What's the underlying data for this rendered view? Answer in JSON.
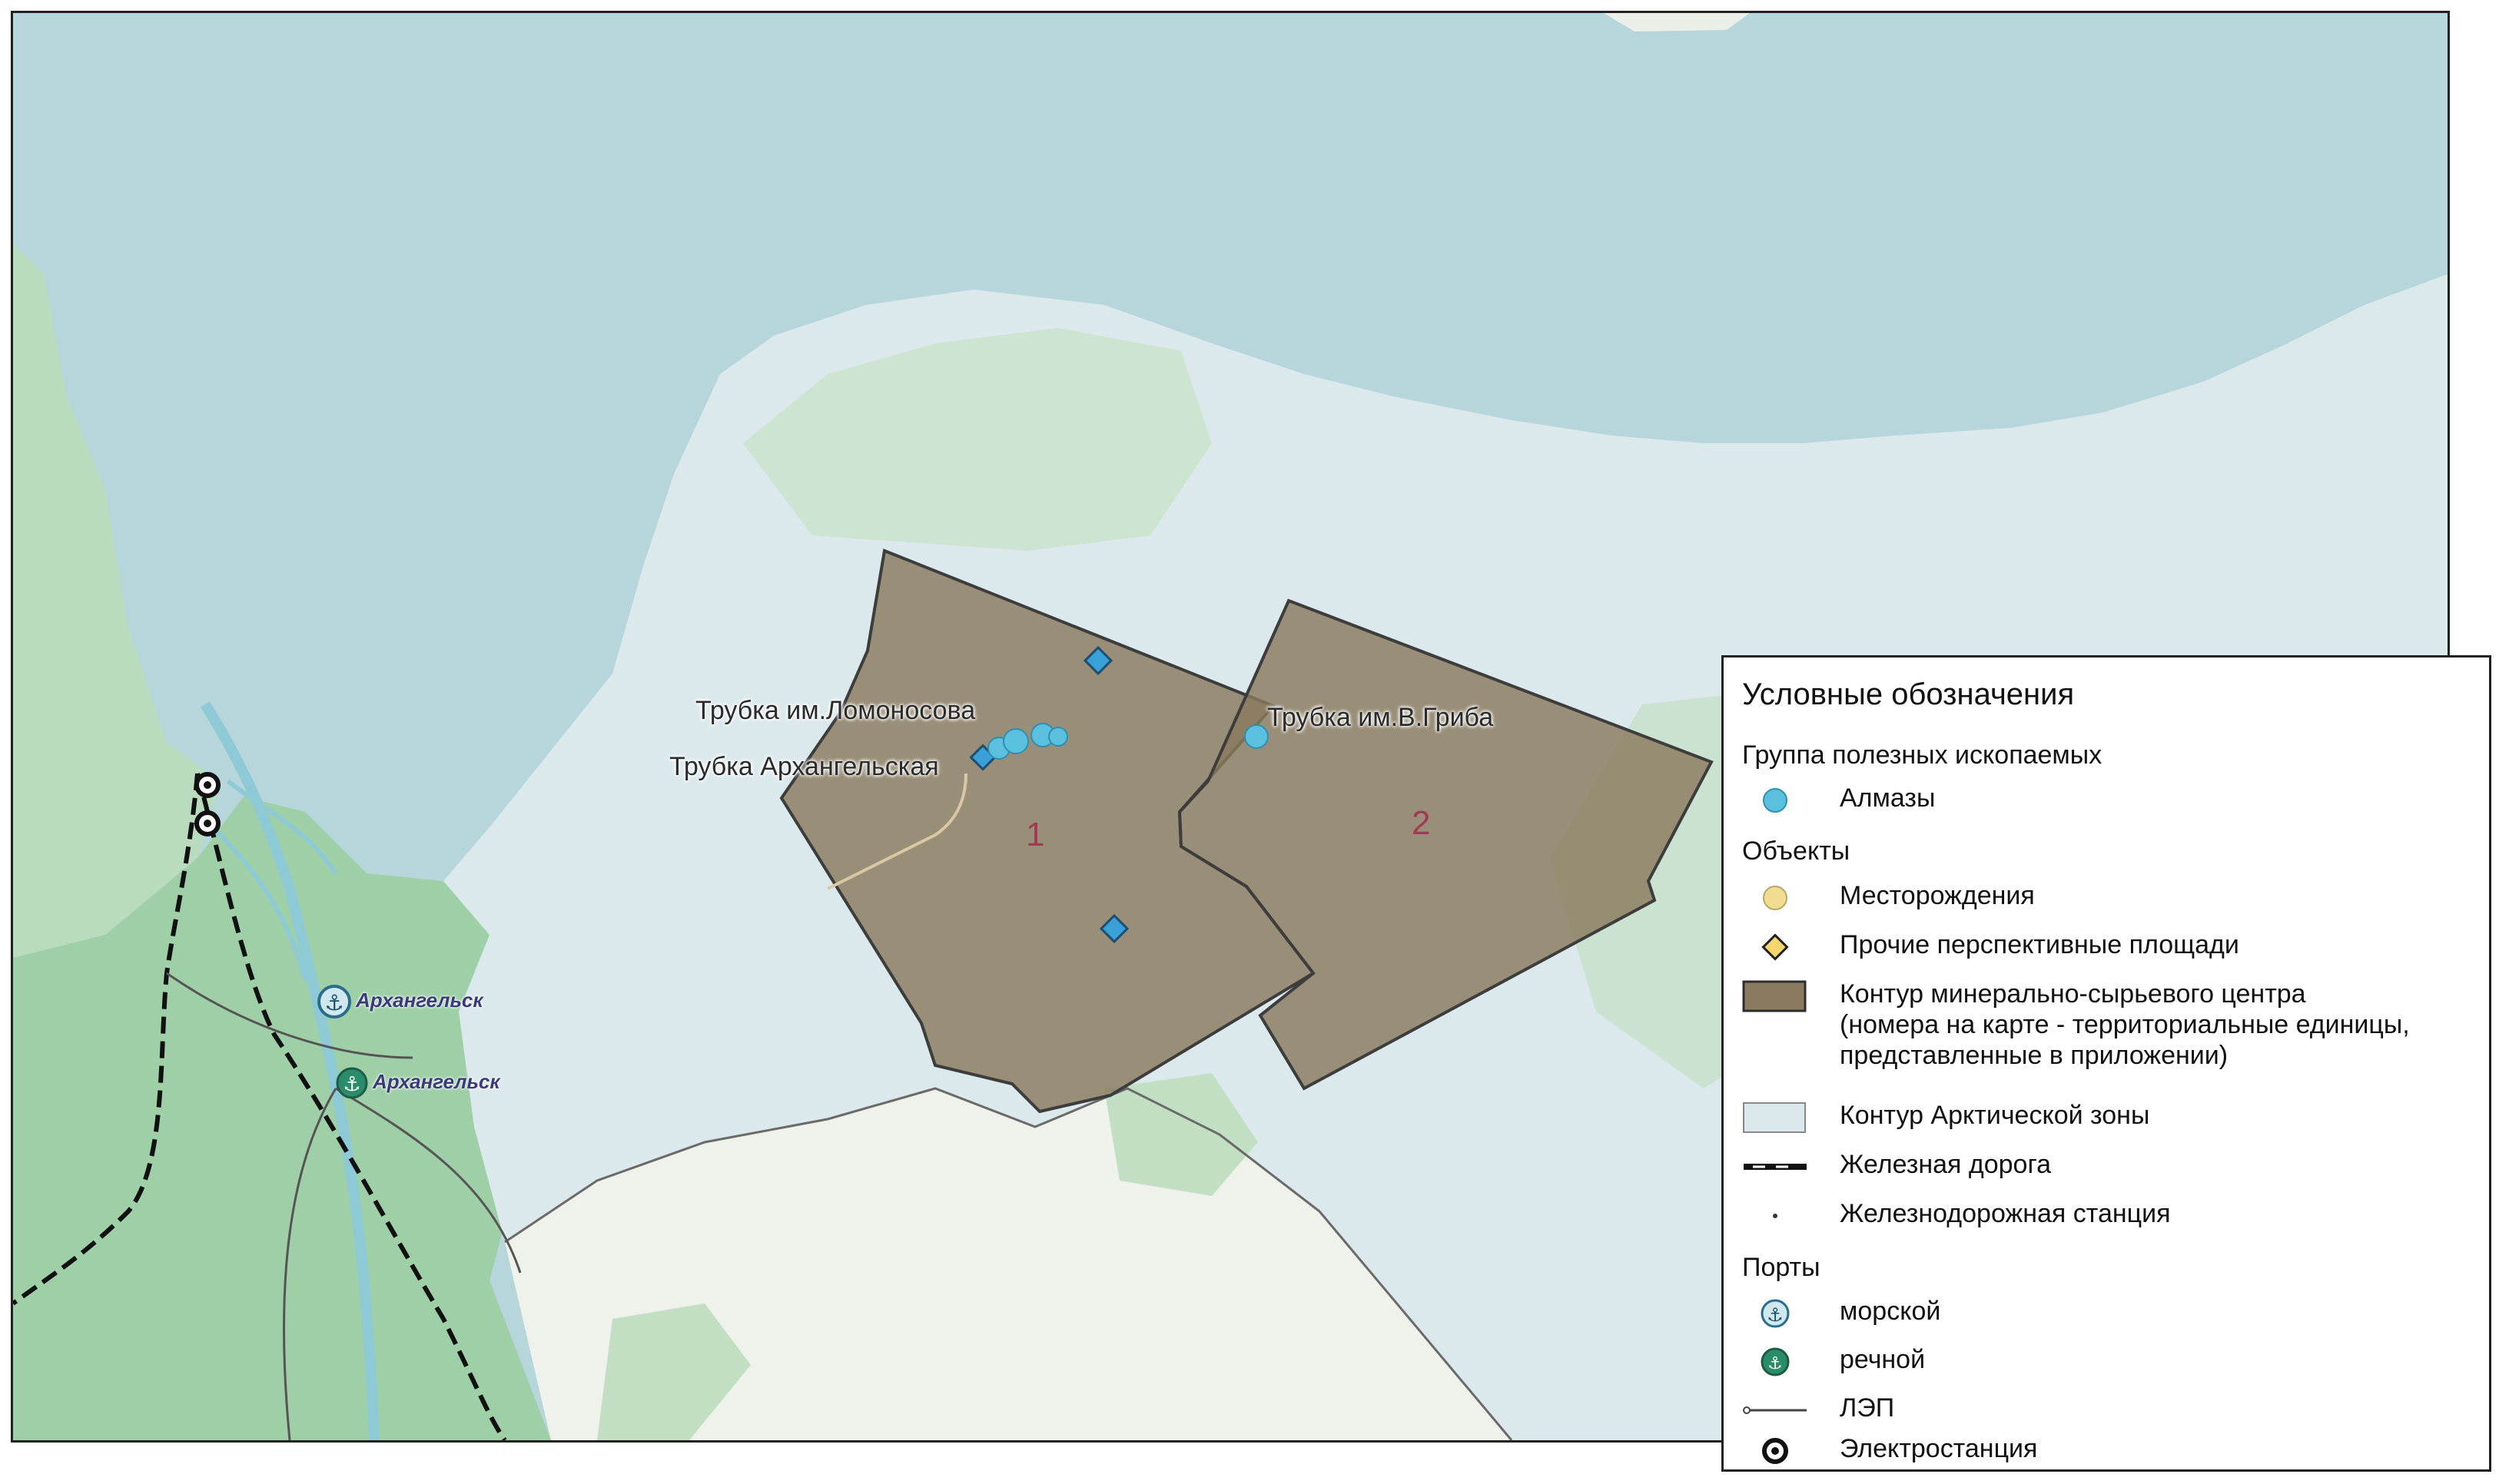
{
  "map": {
    "labels": {
      "lomonosov": "Трубка им.Ломоносова",
      "arkhangelskaya": "Трубка Архангельская",
      "griba": "Трубка им.В.Гриба",
      "unit1": "1",
      "unit2": "2",
      "city_sea": "Архангельск",
      "city_river": "Архангельск"
    },
    "colors": {
      "sea": "#b7d6dc",
      "arctic_zone": "#dce9ec",
      "forest": "#b5d8b8",
      "land": "#eef2ea",
      "mineral_center_fill": "#8a7a5e",
      "diamond": "#5bc0de",
      "prospect": "#3aa0d8"
    }
  },
  "legend": {
    "title": "Условные обозначения",
    "group_minerals": "Группа полезных ископаемых",
    "diamonds": "Алмазы",
    "group_objects": "Объекты",
    "deposits": "Месторождения",
    "prospects": "Прочие перспективные площади",
    "center_line1": "Контур минерально-сырьевого центра",
    "center_line2": "(номера на карте - территориальные единицы,",
    "center_line3": "представленные в приложении)",
    "arctic": "Контур Арктической зоны",
    "railway": "Железная дорога",
    "station": "Железнодорожная станция",
    "group_ports": "Порты",
    "sea_port": "морской",
    "river_port": "речной",
    "power_line": "ЛЭП",
    "power_plant": "Электростанция"
  }
}
